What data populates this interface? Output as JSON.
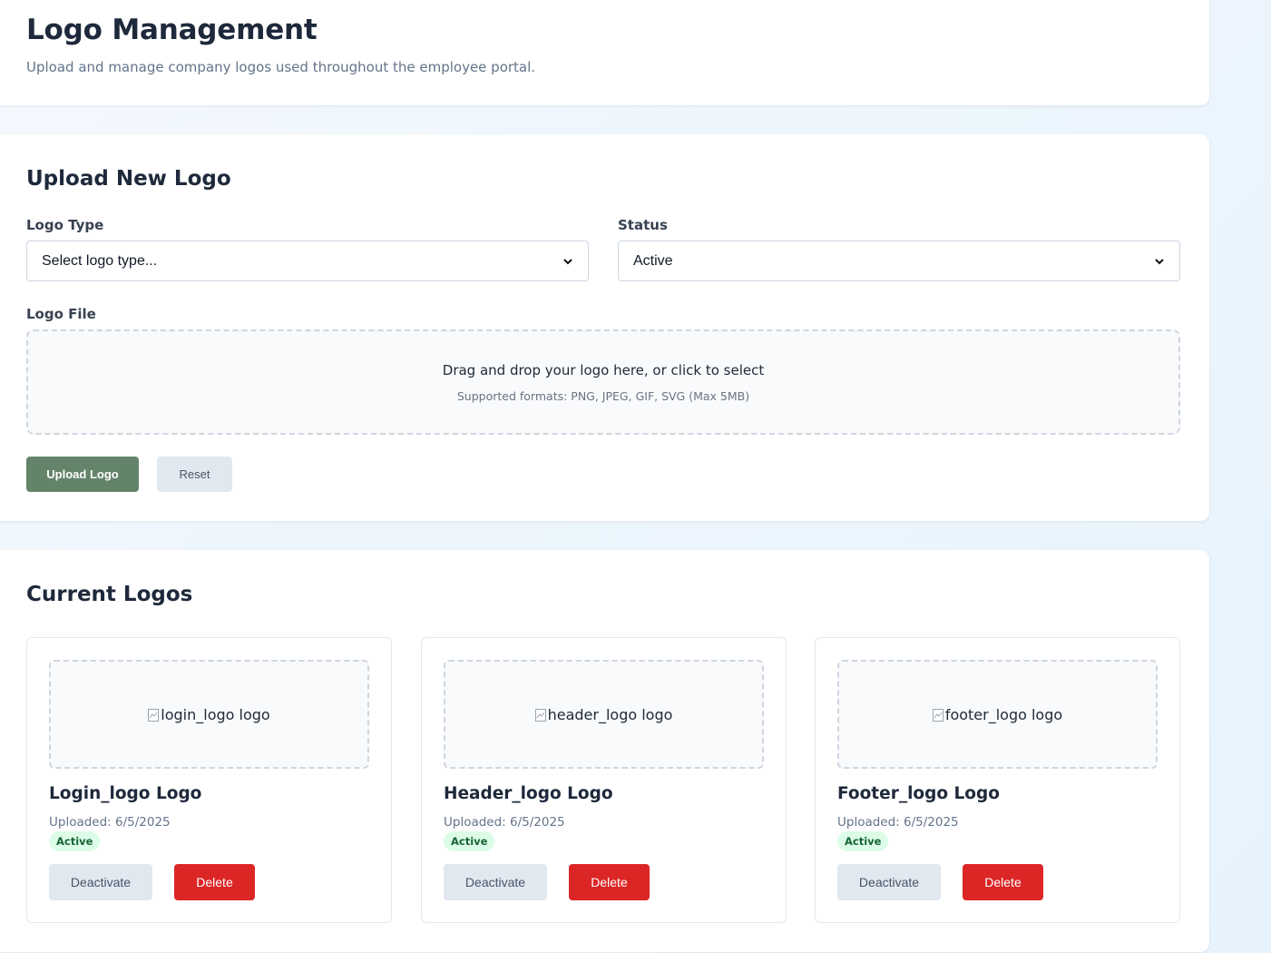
{
  "header": {
    "title": "Logo Management",
    "subtitle": "Upload and manage company logos used throughout the employee portal."
  },
  "upload": {
    "heading": "Upload New Logo",
    "logo_type_label": "Logo Type",
    "logo_type_value": "Select logo type...",
    "status_label": "Status",
    "status_value": "Active",
    "file_label": "Logo File",
    "dropzone_text": "Drag and drop your logo here, or click to select",
    "dropzone_subtext": "Supported formats: PNG, JPEG, GIF, SVG (Max 5MB)",
    "upload_button": "Upload Logo",
    "reset_button": "Reset"
  },
  "current": {
    "heading": "Current Logos",
    "logos": [
      {
        "alt": "login_logo logo",
        "title": "Login_logo Logo",
        "uploaded": "Uploaded: 6/5/2025",
        "status": "Active",
        "deactivate": "Deactivate",
        "delete": "Delete"
      },
      {
        "alt": "header_logo logo",
        "title": "Header_logo Logo",
        "uploaded": "Uploaded: 6/5/2025",
        "status": "Active",
        "deactivate": "Deactivate",
        "delete": "Delete"
      },
      {
        "alt": "footer_logo logo",
        "title": "Footer_logo Logo",
        "uploaded": "Uploaded: 6/5/2025",
        "status": "Active",
        "deactivate": "Deactivate",
        "delete": "Delete"
      }
    ]
  },
  "colors": {
    "primary_button": "#64846a",
    "danger_button": "#dc2626",
    "secondary_button": "#e2e8f0",
    "badge_bg": "#dcfce7",
    "badge_text": "#166534"
  },
  "icons": {
    "select_caret": "chevron-down-icon",
    "broken_image": "broken-image-icon"
  }
}
